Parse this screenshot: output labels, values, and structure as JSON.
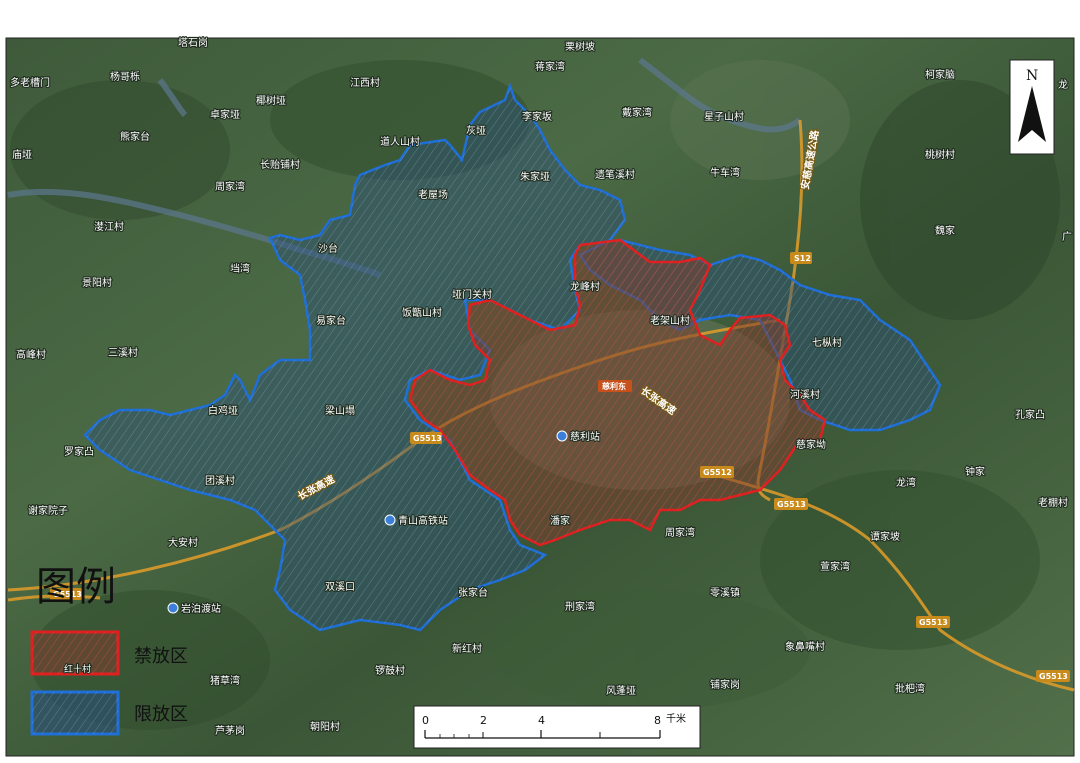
{
  "legend": {
    "title": "图例",
    "items": [
      {
        "label": "禁放区",
        "color": "#e02020",
        "sample": "红十村"
      },
      {
        "label": "限放区",
        "color": "#1f6fd8"
      }
    ]
  },
  "north_arrow": {
    "label": "N"
  },
  "scale_bar": {
    "ticks": [
      "0",
      "2",
      "4",
      "8"
    ],
    "unit": "千米"
  },
  "highways": [
    {
      "label": "长张高速",
      "kind": "name"
    },
    {
      "label": "长张高速",
      "kind": "name"
    },
    {
      "label": "安慈高速公路",
      "kind": "name"
    },
    {
      "label": "G5513",
      "kind": "shield"
    },
    {
      "label": "G5513",
      "kind": "shield"
    },
    {
      "label": "G5513",
      "kind": "shield"
    },
    {
      "label": "G5513",
      "kind": "shield"
    },
    {
      "label": "G5513",
      "kind": "shield"
    },
    {
      "label": "S12",
      "kind": "shield"
    },
    {
      "label": "G5512",
      "kind": "shield"
    },
    {
      "label": "慈利东",
      "kind": "shield"
    }
  ],
  "stations": [
    "慈利站",
    "青山高铁站",
    "岩泊渡站"
  ],
  "places": [
    "塔石岗",
    "栗树坡",
    "多老槽门",
    "杨哥栎",
    "江西村",
    "蒋家湾",
    "柯家脑",
    "龙",
    "戴家湾",
    "李家坂",
    "卓家垭",
    "椰树垭",
    "灰垭",
    "星子山村",
    "庙垭",
    "熊家台",
    "道人山村",
    "长贻铺村",
    "朱家垭",
    "遗笔溪村",
    "牛车湾",
    "桃树村",
    "周家湾",
    "老屋场",
    "漤江村",
    "魏家",
    "广",
    "沙台",
    "龙峰村",
    "景阳村",
    "垱湾",
    "垭门关村",
    "老架山村",
    "饭甑山村",
    "易家台",
    "七枞村",
    "高峰村",
    "三溪村",
    "河溪村",
    "白鸡垭",
    "梁山塌",
    "孔家凸",
    "罗家凸",
    "慈家坳",
    "团溪村",
    "钟家",
    "龙湾",
    "老棚村",
    "谢家院子",
    "潘家",
    "周家湾",
    "谭家坡",
    "大安村",
    "萱家湾",
    "双溪口",
    "张家台",
    "刑家湾",
    "零溪镇",
    "新红村",
    "象鼻嘴村",
    "锣鼓村",
    "风蓬垭",
    "铺家岗",
    "猪草湾",
    "批杷湾",
    "朝阳村",
    "芦茅岗"
  ]
}
